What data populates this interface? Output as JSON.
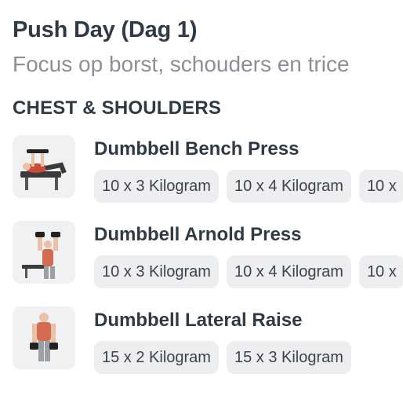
{
  "workout": {
    "title": "Push Day (Dag 1)",
    "subtitle": "Focus op borst, schouders en trice"
  },
  "section": {
    "label": "CHEST & SHOULDERS"
  },
  "exercises": [
    {
      "name": "Dumbbell Bench Press",
      "image": "dumbbell-bench-press-illustration",
      "sets": [
        "10 x 3 Kilogram",
        "10 x 4 Kilogram",
        "10 x"
      ]
    },
    {
      "name": "Dumbbell Arnold Press",
      "image": "dumbbell-arnold-press-illustration",
      "sets": [
        "10 x 3 Kilogram",
        "10 x 4 Kilogram",
        "10 x"
      ]
    },
    {
      "name": "Dumbbell Lateral Raise",
      "image": "dumbbell-lateral-raise-illustration",
      "sets": [
        "15 x 2 Kilogram",
        "15 x 3 Kilogram"
      ]
    }
  ]
}
